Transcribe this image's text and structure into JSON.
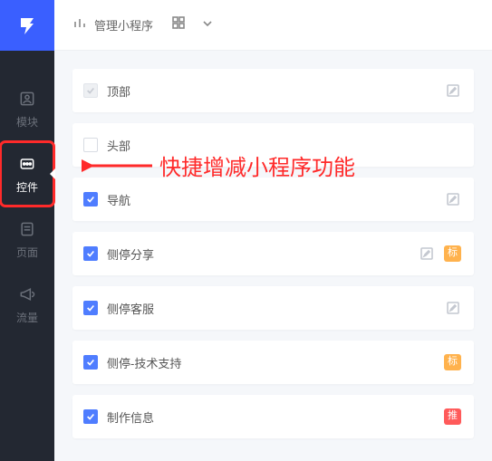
{
  "topbar": {
    "manage_label": "管理小程序"
  },
  "sidebar": {
    "items": [
      {
        "label": "模块"
      },
      {
        "label": "控件"
      },
      {
        "label": "页面"
      },
      {
        "label": "流量"
      }
    ]
  },
  "cards": [
    {
      "label": "顶部",
      "checked": true,
      "disabled": true,
      "edit": true,
      "badge": null
    },
    {
      "label": "头部",
      "checked": false,
      "disabled": false,
      "edit": false,
      "badge": null
    },
    {
      "label": "导航",
      "checked": true,
      "disabled": false,
      "edit": true,
      "badge": null
    },
    {
      "label": "侧停分享",
      "checked": true,
      "disabled": false,
      "edit": true,
      "badge": {
        "text": "标",
        "cls": "orange"
      }
    },
    {
      "label": "侧停客服",
      "checked": true,
      "disabled": false,
      "edit": true,
      "badge": null
    },
    {
      "label": "侧停-技术支持",
      "checked": true,
      "disabled": false,
      "edit": false,
      "badge": {
        "text": "标",
        "cls": "orange"
      }
    },
    {
      "label": "制作信息",
      "checked": true,
      "disabled": false,
      "edit": false,
      "badge": {
        "text": "推",
        "cls": "red"
      }
    }
  ],
  "annotation": {
    "text": "快捷增减小程序功能"
  }
}
